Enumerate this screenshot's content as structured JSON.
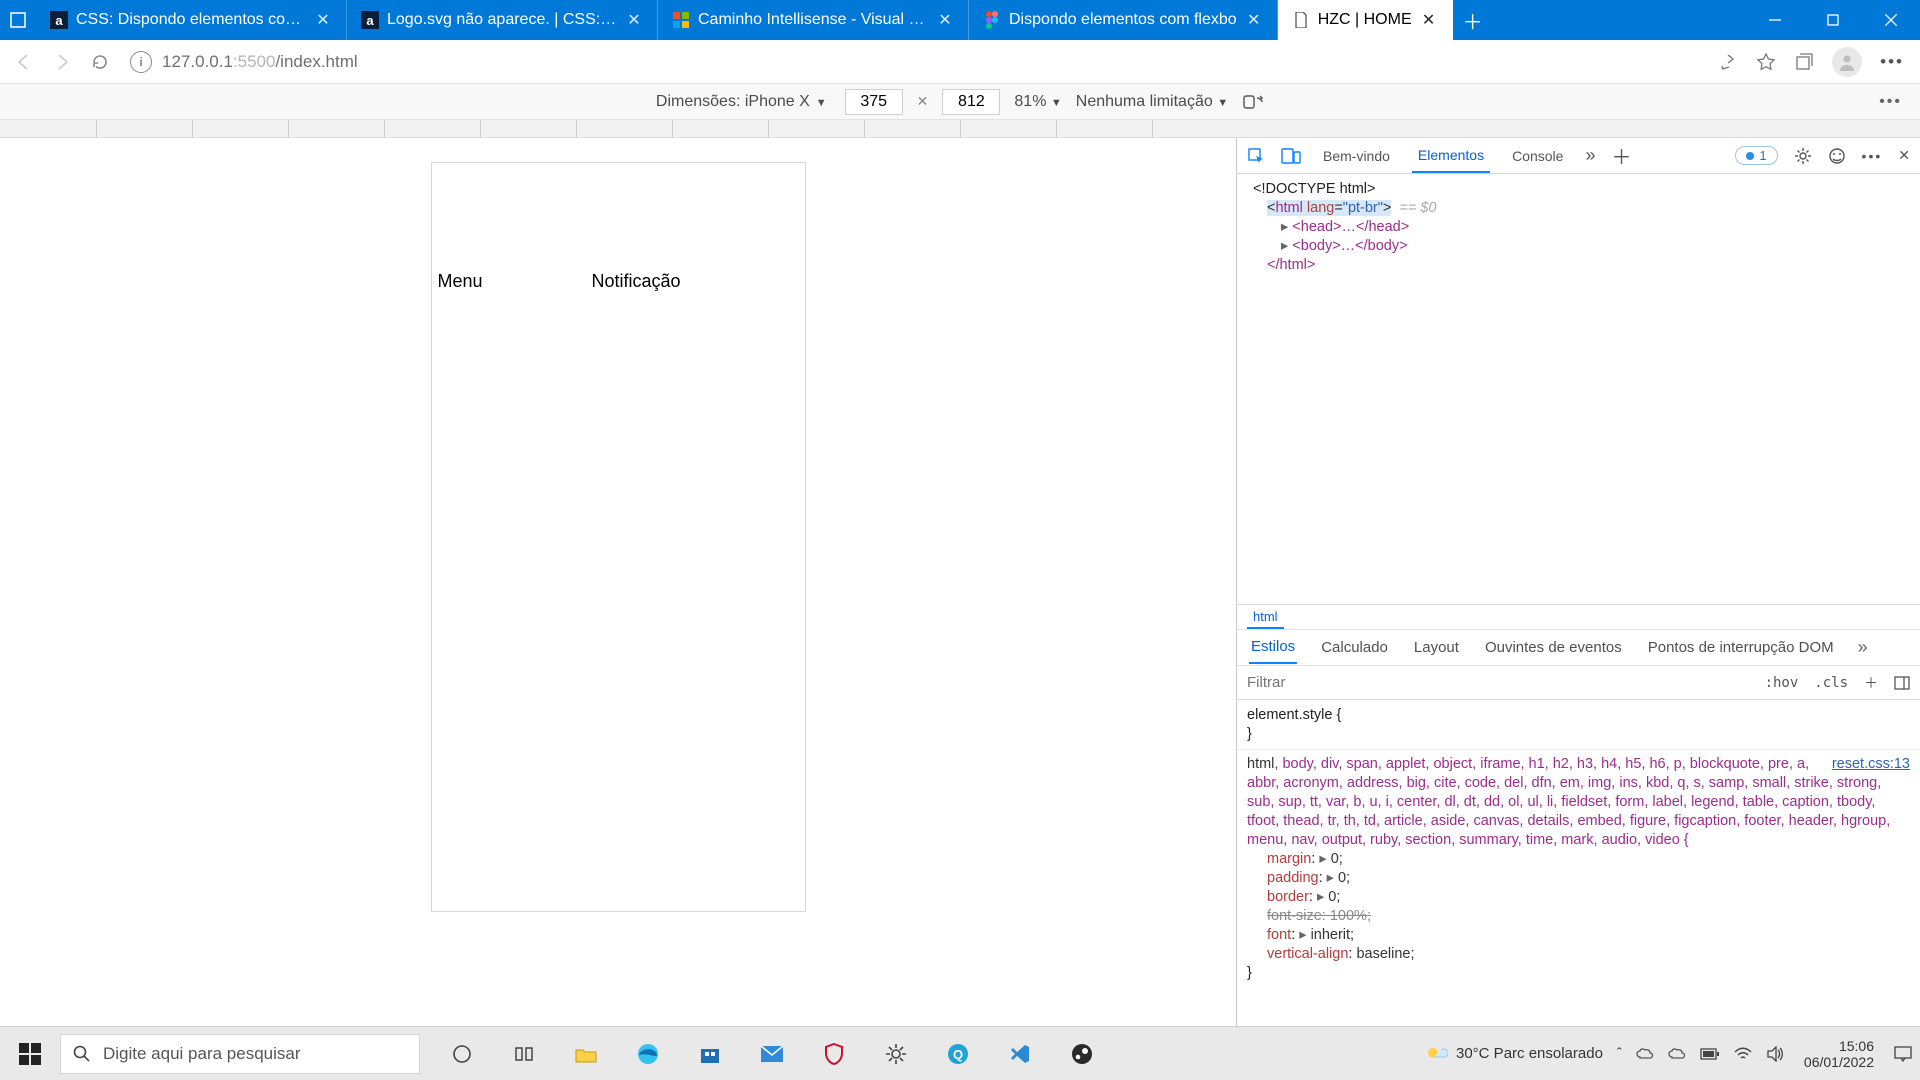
{
  "tabs": [
    {
      "title": "CSS: Dispondo elementos com F",
      "favicon": "a-blue"
    },
    {
      "title": "Logo.svg não aparece. | CSS: Dis",
      "favicon": "a-blue"
    },
    {
      "title": "Caminho Intellisense - Visual Stu",
      "favicon": "vs-store"
    },
    {
      "title": "Dispondo elementos com flexbo",
      "favicon": "figma"
    },
    {
      "title": "HZC | HOME",
      "favicon": "file"
    }
  ],
  "active_tab_index": 4,
  "url": {
    "host": "127.0.0.1",
    "port": ":5500",
    "path": "/index.html"
  },
  "devbar": {
    "label": "Dimensões: iPhone X",
    "width": "375",
    "height": "812",
    "zoom": "81%",
    "throttle": "Nenhuma limitação"
  },
  "page": {
    "menu": "Menu",
    "notif": "Notificação"
  },
  "devtools": {
    "tabs": {
      "welcome": "Bem-vindo",
      "elements": "Elementos",
      "console": "Console"
    },
    "issues": "1",
    "dom": {
      "doctype": "<!DOCTYPE html>",
      "html_open": "html",
      "html_lang_attr": "lang",
      "html_lang_val": "\"pt-br\"",
      "eq0": "== $0",
      "head": "<head>…</head>",
      "body": "<body>…</body>",
      "html_close": "</html>"
    },
    "crumb": "html",
    "style_tabs": {
      "styles": "Estilos",
      "computed": "Calculado",
      "layout": "Layout",
      "listeners": "Ouvintes de eventos",
      "breakpoints": "Pontos de interrupção DOM"
    },
    "filter_placeholder": "Filtrar",
    "hov": ":hov",
    "cls": ".cls",
    "element_style": "element.style {",
    "brace_close": "}",
    "reset_link": "reset.css:13",
    "selectors": "html, body, div, span, applet, object, iframe, h1, h2, h3, h4, h5, h6, p, blockquote, pre, a, abbr, acronym, address, big, cite, code, del, dfn, em, img, ins, kbd, q, s, samp, small, strike, strong, sub, sup, tt, var, b, u, i, center, dl, dt, dd, ol, ul, li, fieldset, form, label, legend, table, caption, tbody, tfoot, thead, tr, th, td, article, aside, canvas, details, embed, figure, figcaption, footer, header, hgroup, menu, nav, output, ruby, section, summary, time, mark, audio, video {",
    "props": {
      "margin": "margin",
      "margin_v": "0;",
      "padding": "padding",
      "padding_v": "0;",
      "border": "border",
      "border_v": "0;",
      "fontsize": "font-size: 100%;",
      "font": "font",
      "font_v": "inherit;",
      "valign": "vertical-align",
      "valign_v": "baseline;"
    }
  },
  "taskbar": {
    "search_placeholder": "Digite aqui para pesquisar",
    "weather": "30°C  Parc ensolarado",
    "time": "15:06",
    "date": "06/01/2022"
  }
}
